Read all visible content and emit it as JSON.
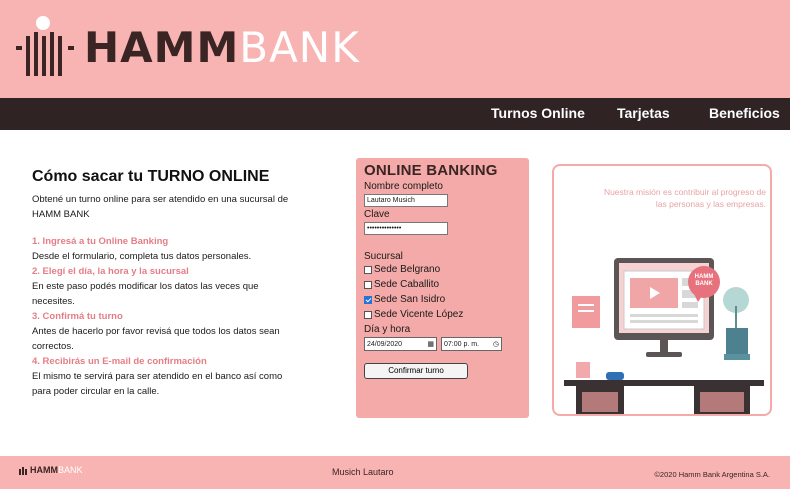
{
  "brand": {
    "name_bold": "HAMM",
    "name_light": "BANK"
  },
  "nav": {
    "items": [
      {
        "label": "Turnos Online"
      },
      {
        "label": "Tarjetas"
      },
      {
        "label": "Beneficios"
      }
    ]
  },
  "info": {
    "title": "Cómo sacar tu TURNO ONLINE",
    "intro": "Obtené un turno online para ser atendido en una sucursal de HAMM BANK",
    "steps": [
      {
        "title": "1. Ingresá a tu Online Banking",
        "text": "Desde el formulario, completa tus datos personales."
      },
      {
        "title": "2. Elegí el día, la hora y la sucursal",
        "text": "En este paso podés modificar los datos las veces que necesites."
      },
      {
        "title": "3. Confirmá tu turno",
        "text": "Antes de hacerlo por favor revisá que todos los datos sean correctos."
      },
      {
        "title": "4. Recibirás un E-mail de confirmación",
        "text": "El mismo te servirá para ser atendido en el banco así como para poder circular en la calle."
      }
    ]
  },
  "form": {
    "title": "ONLINE BANKING",
    "name_label": "Nombre completo",
    "name_value": "Lautaro Musich",
    "password_label": "Clave",
    "password_value": "••••••••••••••",
    "branch_label": "Sucursal",
    "branches": [
      {
        "label": "Sede Belgrano",
        "checked": false
      },
      {
        "label": "Sede Caballito",
        "checked": false
      },
      {
        "label": "Sede San Isidro",
        "checked": true
      },
      {
        "label": "Sede Vicente López",
        "checked": false
      }
    ],
    "datetime_label": "Día y hora",
    "date_value": "24/09/2020",
    "time_value": "07:00 p. m.",
    "submit_label": "Confirmar turno"
  },
  "illustration": {
    "mission": "Nuestra misión es contribuir al progreso de las personas y las empresas.",
    "badge_line1": "HAMM",
    "badge_line2": "BANK"
  },
  "footer": {
    "logo_bold": "HAMM",
    "logo_light": "BANK",
    "author": "Musich Lautaro",
    "copyright": "©2020 Hamm Bank Argentina S.A."
  },
  "colors": {
    "pink": "#f8b4b2",
    "dark": "#2f2423",
    "accent": "#e57d86"
  }
}
